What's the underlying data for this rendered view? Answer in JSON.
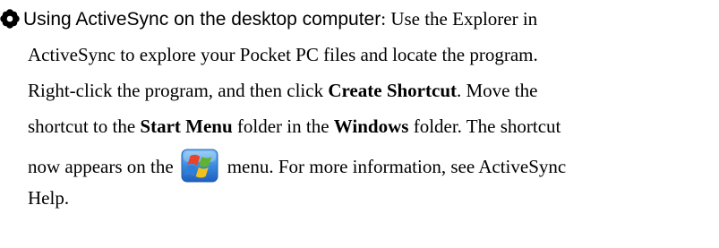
{
  "heading": "Using ActiveSync on the desktop computer",
  "heading_colon": ":",
  "line1_rest": " Use the Explorer in",
  "line2": "ActiveSync to explore your Pocket PC files and locate the program.",
  "line3_a": "Right-click the program, and then click ",
  "line3_b": "Create Shortcut",
  "line3_c": ". Move the",
  "line4_a": "shortcut to the ",
  "line4_b": "Start Menu",
  "line4_c": " folder in the ",
  "line4_d": "Windows",
  "line4_e": " folder. The shortcut",
  "line5_a": "now appears on the",
  "line5_b": "menu. For more information, see ActiveSync",
  "line6": "Help.",
  "icons": {
    "bullet": "flower-bullet-icon",
    "start": "windows-start-flag-icon"
  },
  "colors": {
    "text": "#000000",
    "flag_red": "#e8442a",
    "flag_green": "#5fb32f",
    "flag_blue": "#2f7fd8",
    "flag_yellow": "#f3c21a",
    "icon_bg_top": "#5aa9f0",
    "icon_bg_bottom": "#1f5fbf"
  }
}
